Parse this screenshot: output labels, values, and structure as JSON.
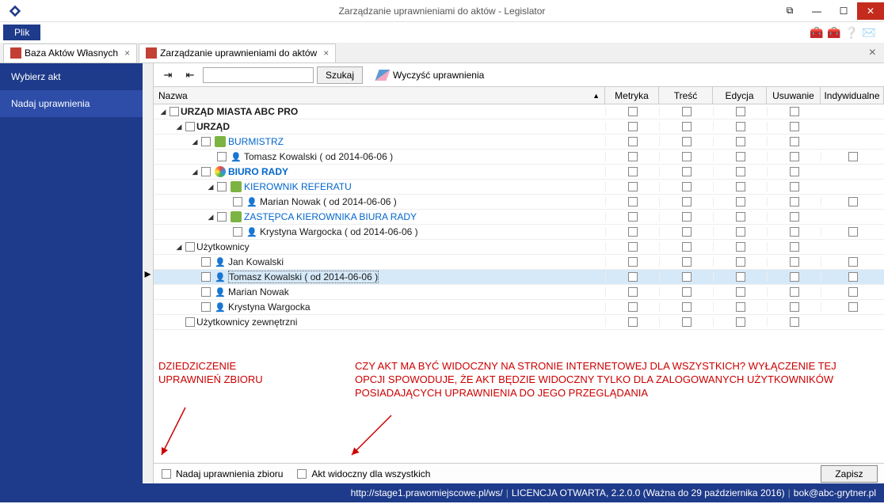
{
  "window": {
    "title": "Zarządzanie uprawnieniami do aktów - Legislator"
  },
  "menu": {
    "file": "Plik"
  },
  "tabs": [
    {
      "label": "Baza Aktów Własnych"
    },
    {
      "label": "Zarządzanie uprawnieniami do aktów"
    }
  ],
  "sidebar": {
    "items": [
      {
        "label": "Wybierz akt"
      },
      {
        "label": "Nadaj uprawnienia"
      }
    ]
  },
  "toolbar": {
    "search_btn": "Szukaj",
    "clear_perm": "Wyczyść uprawnienia"
  },
  "grid": {
    "cols": {
      "name": "Nazwa",
      "metric": "Metryka",
      "content": "Treść",
      "edit": "Edycja",
      "delete": "Usuwanie",
      "individual": "Indywidualne"
    }
  },
  "tree": {
    "r0": "URZĄD MIASTA ABC PRO",
    "r1": "URZĄD",
    "r2": "BURMISTRZ",
    "r3": "Tomasz Kowalski ( od 2014-06-06 )",
    "r4": "BIURO RADY",
    "r5": "KIEROWNIK REFERATU",
    "r6": "Marian Nowak ( od 2014-06-06 )",
    "r7": "ZASTĘPCA KIEROWNIKA BIURA RADY",
    "r8": "Krystyna Wargocka ( od 2014-06-06 )",
    "r9": "Użytkownicy",
    "r10": "Jan Kowalski",
    "r11": "Tomasz Kowalski ( od 2014-06-06 )",
    "r12": "Marian Nowak",
    "r13": "Krystyna Wargocka",
    "r14": "Użytkownicy zewnętrzni"
  },
  "annotations": {
    "left": "DZIEDZICZENIE UPRAWNIEŃ ZBIORU",
    "right": "CZY AKT MA BYĆ WIDOCZNY NA STRONIE INTERNETOWEJ DLA WSZYSTKICH? WYŁĄCZENIE TEJ OPCJI SPOWODUJE, ŻE AKT BĘDZIE WIDOCZNY TYLKO DLA ZALOGOWANYCH UŻYTKOWNIKÓW POSIADAJĄCYCH UPRAWNIENIA DO JEGO PRZEGLĄDANIA"
  },
  "bottom": {
    "inherit": "Nadaj uprawnienia zbioru",
    "visible": "Akt widoczny dla wszystkich",
    "save": "Zapisz"
  },
  "status": {
    "url": "http://stage1.prawomiejscowe.pl/ws/",
    "license": "LICENCJA OTWARTA, 2.2.0.0 (Ważna do 29 października 2016)",
    "email": "bok@abc-grytner.pl"
  }
}
